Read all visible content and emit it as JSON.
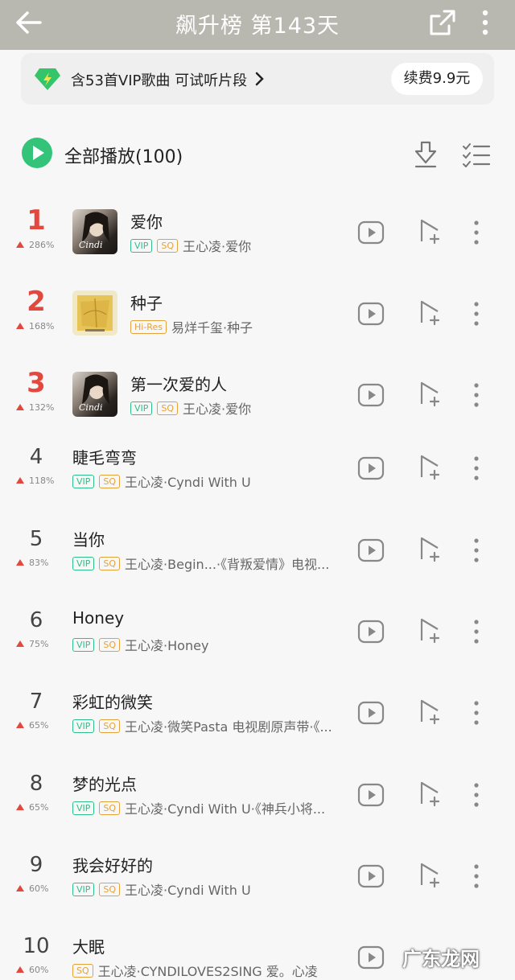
{
  "header": {
    "title": "飙升榜 第143天"
  },
  "vip_bar": {
    "text": "含53首VIP歌曲 可试听片段",
    "renew_label": "续费9.9元"
  },
  "play_all": {
    "label": "全部播放(100)"
  },
  "tags": {
    "vip": "VIP",
    "sq": "SQ",
    "hires": "Hi-Res"
  },
  "songs": [
    {
      "rank": "1",
      "trend": "286%",
      "title": "爱你",
      "artist": "王心凌·爱你"
    },
    {
      "rank": "2",
      "trend": "168%",
      "title": "种子",
      "artist": "易烊千玺·种子"
    },
    {
      "rank": "3",
      "trend": "132%",
      "title": "第一次爱的人",
      "artist": "王心凌·爱你"
    },
    {
      "rank": "4",
      "trend": "118%",
      "title": "睫毛弯弯",
      "artist": "王心凌·Cyndi With U"
    },
    {
      "rank": "5",
      "trend": "83%",
      "title": "当你",
      "artist": "王心凌·Begin...·《背叛爱情》电视..."
    },
    {
      "rank": "6",
      "trend": "75%",
      "title": "Honey",
      "artist": "王心凌·Honey"
    },
    {
      "rank": "7",
      "trend": "65%",
      "title": "彩虹的微笑",
      "artist": "王心凌·微笑Pasta 电视剧原声带·《..."
    },
    {
      "rank": "8",
      "trend": "65%",
      "title": "梦的光点",
      "artist": "王心凌·Cyndi With U·《神兵小将..."
    },
    {
      "rank": "9",
      "trend": "60%",
      "title": "我会好好的",
      "artist": "王心凌·Cyndi With U"
    },
    {
      "rank": "10",
      "trend": "60%",
      "title": "大眠",
      "artist": "王心凌·CYNDILOVES2SING 爱。心凌"
    }
  ],
  "watermark": "广东龙网",
  "colors": {
    "header_bg": "#b8b8b0",
    "accent_green": "#2fbf8a",
    "rank_red": "#e2483e",
    "sq_gold": "#e3a23a"
  }
}
